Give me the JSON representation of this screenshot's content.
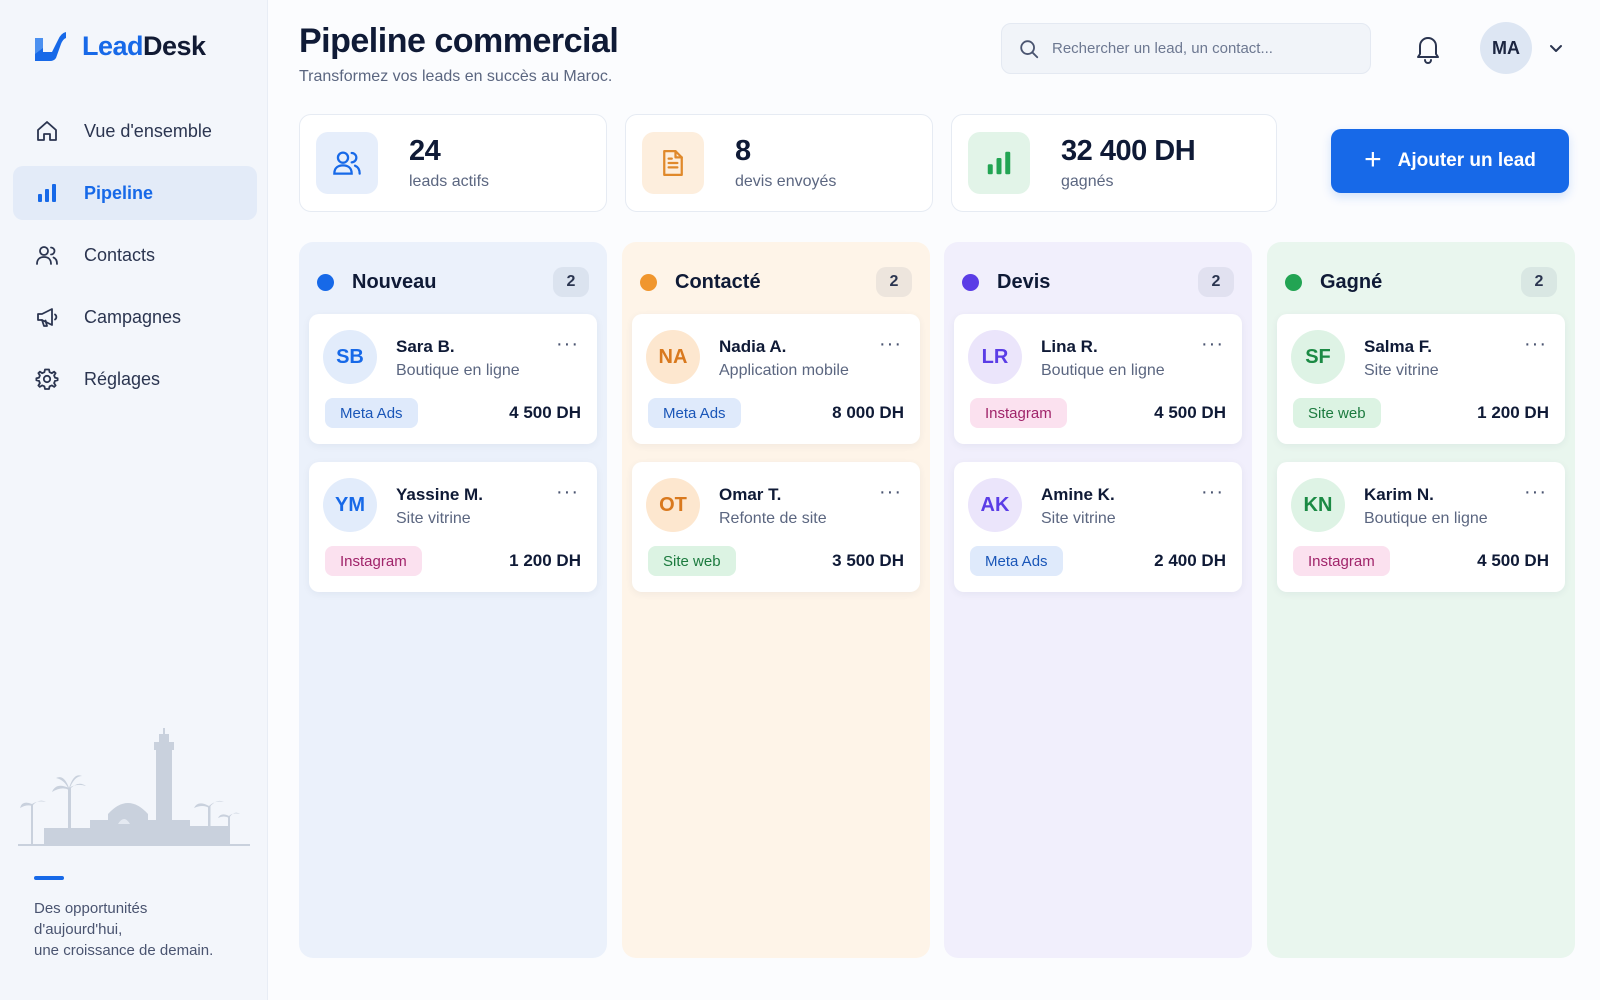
{
  "brand": {
    "name_part1": "Lead",
    "name_part2": "Desk",
    "color": "#1769e8"
  },
  "sidebar": {
    "items": [
      {
        "label": "Vue d'ensemble",
        "icon": "home-icon",
        "active": false
      },
      {
        "label": "Pipeline",
        "icon": "bar-chart-icon",
        "active": true
      },
      {
        "label": "Contacts",
        "icon": "users-icon",
        "active": false
      },
      {
        "label": "Campagnes",
        "icon": "megaphone-icon",
        "active": false
      },
      {
        "label": "Réglages",
        "icon": "gear-icon",
        "active": false
      }
    ],
    "quote_lines": [
      "Des opportunités",
      "d'aujourd'hui,",
      "une croissance de demain."
    ]
  },
  "header": {
    "title": "Pipeline commercial",
    "subtitle": "Transformez vos leads en succès au Maroc.",
    "search_placeholder": "Rechercher un lead, un contact...",
    "user_initials": "MA"
  },
  "stats": [
    {
      "value": "24",
      "label": "leads actifs",
      "icon": "users-icon"
    },
    {
      "value": "8",
      "label": "devis envoyés",
      "icon": "document-icon"
    },
    {
      "value": "32 400 DH",
      "label": "gagnés",
      "icon": "bar-chart-icon"
    }
  ],
  "add_button": {
    "label": "Ajouter un lead"
  },
  "columns": [
    {
      "title": "Nouveau",
      "count": "2",
      "dot_color": "#1769e8",
      "cards": [
        {
          "initials": "SB",
          "name": "Sara B.",
          "project": "Boutique en ligne",
          "tag": "Meta Ads",
          "amount": "4 500 DH"
        },
        {
          "initials": "YM",
          "name": "Yassine M.",
          "project": "Site vitrine",
          "tag": "Instagram",
          "amount": "1 200 DH"
        }
      ]
    },
    {
      "title": "Contacté",
      "count": "2",
      "dot_color": "#f0962e",
      "cards": [
        {
          "initials": "NA",
          "name": "Nadia A.",
          "project": "Application mobile",
          "tag": "Meta Ads",
          "amount": "8 000 DH"
        },
        {
          "initials": "OT",
          "name": "Omar T.",
          "project": "Refonte de site",
          "tag": "Site web",
          "amount": "3 500 DH"
        }
      ]
    },
    {
      "title": "Devis",
      "count": "2",
      "dot_color": "#5b3de6",
      "cards": [
        {
          "initials": "LR",
          "name": "Lina R.",
          "project": "Boutique en ligne",
          "tag": "Instagram",
          "amount": "4 500 DH"
        },
        {
          "initials": "AK",
          "name": "Amine K.",
          "project": "Site vitrine",
          "tag": "Meta Ads",
          "amount": "2 400 DH"
        }
      ]
    },
    {
      "title": "Gagné",
      "count": "2",
      "dot_color": "#22a453",
      "cards": [
        {
          "initials": "SF",
          "name": "Salma F.",
          "project": "Site vitrine",
          "tag": "Site web",
          "amount": "1 200 DH"
        },
        {
          "initials": "KN",
          "name": "Karim N.",
          "project": "Boutique en ligne",
          "tag": "Instagram",
          "amount": "4 500 DH"
        }
      ]
    }
  ]
}
